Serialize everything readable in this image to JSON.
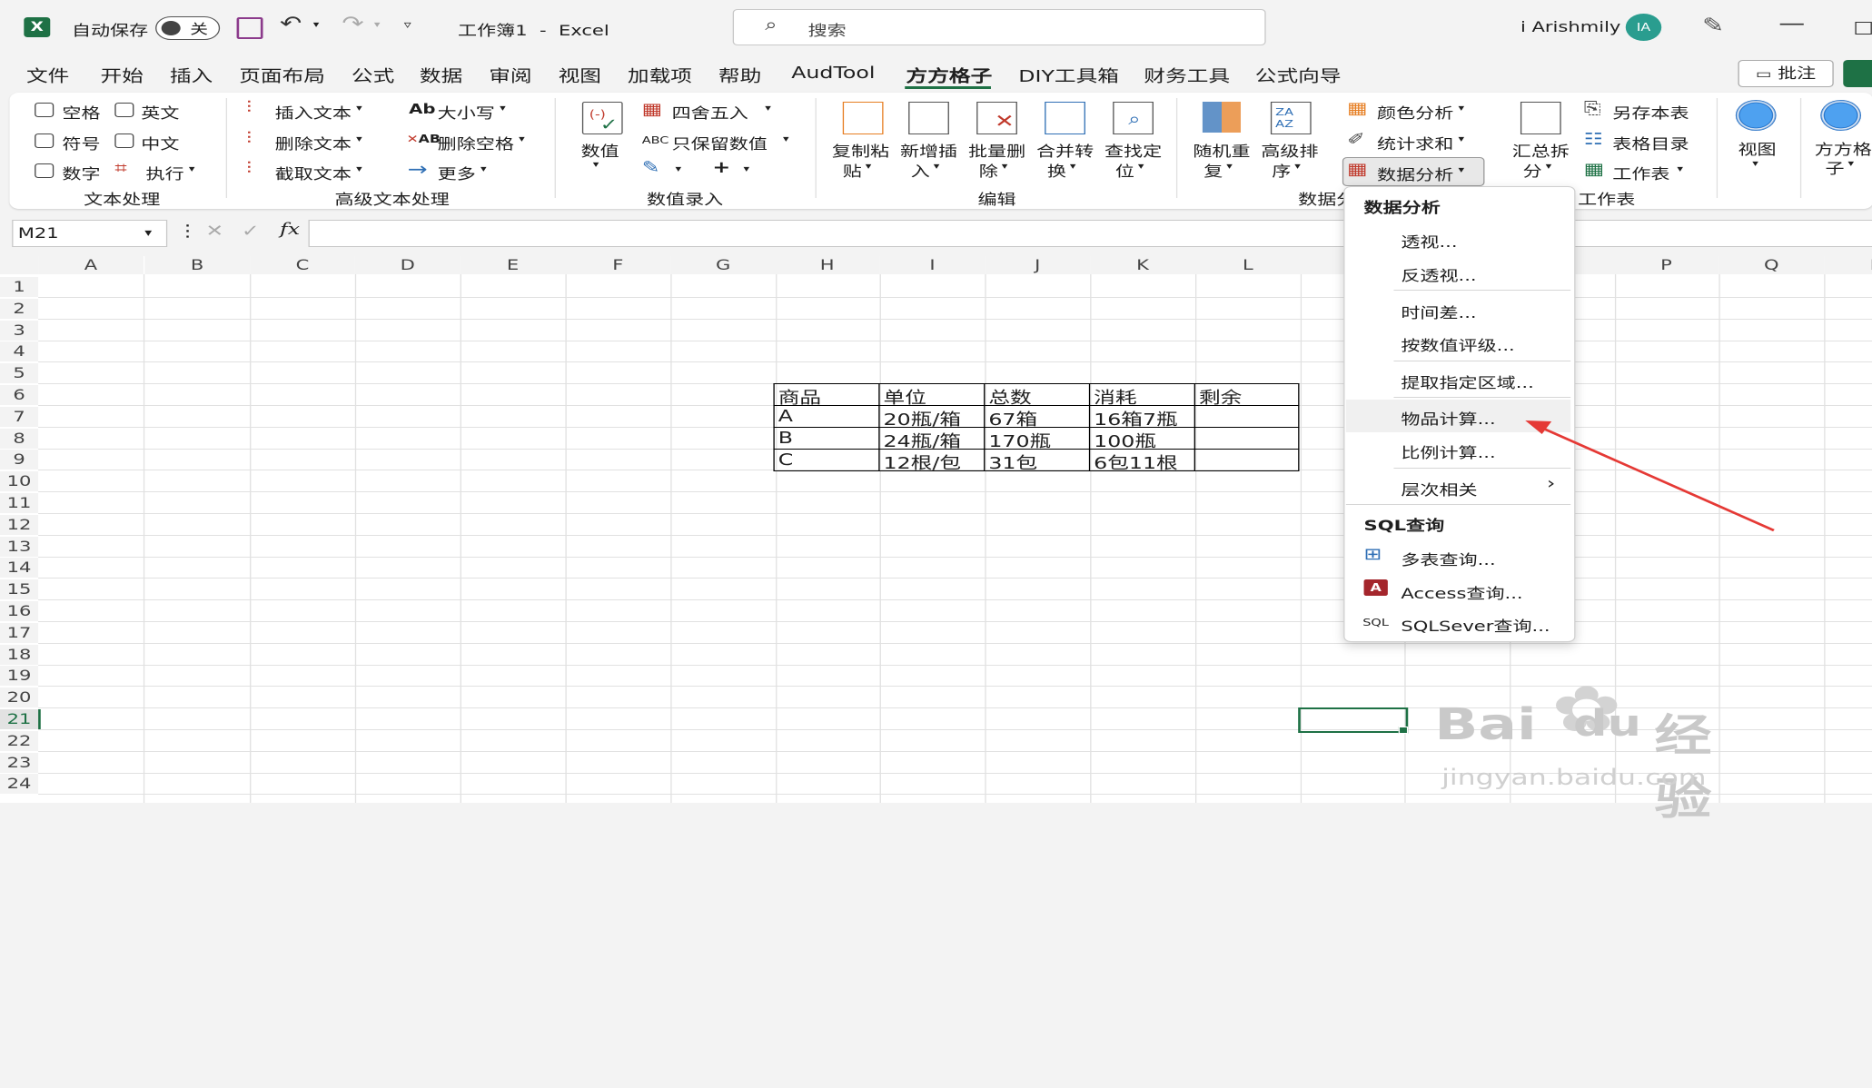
{
  "titlebar": {
    "autosave_label": "自动保存",
    "autosave_state": "关",
    "doc_title": "工作簿1  -  Excel",
    "search_placeholder": "搜索",
    "user_name": "i Arishmily",
    "user_initials": "IA"
  },
  "menu": {
    "tabs": [
      "文件",
      "开始",
      "插入",
      "页面布局",
      "公式",
      "数据",
      "审阅",
      "视图",
      "加载项",
      "帮助",
      "AudTool",
      "方方格子",
      "DIY工具箱",
      "财务工具",
      "公式向导"
    ],
    "active": "方方格子",
    "comment_label": "批注"
  },
  "ribbon": {
    "text": {
      "space": "空格",
      "english": "英文",
      "symbol": "符号",
      "chinese": "中文",
      "number": "数字",
      "execute": "执行",
      "group": "文本处理"
    },
    "advtext": {
      "insert": "插入文本",
      "delete": "删除文本",
      "cut": "截取文本",
      "case": "大小写",
      "del_space": "删除空格",
      "more": "更多",
      "group": "高级文本处理"
    },
    "numinput": {
      "value": "数值",
      "round": "四舍五入",
      "keep_num": "只保留数值",
      "group": "数值录入"
    },
    "edit": {
      "copy": [
        "复制粘",
        "贴"
      ],
      "newins": [
        "新增插",
        "入"
      ],
      "batchdel": [
        "批量删",
        "除"
      ],
      "merge": [
        "合并转",
        "换"
      ],
      "find": [
        "查找定",
        "位"
      ],
      "group": "编辑"
    },
    "data": {
      "random": [
        "随机重",
        "复"
      ],
      "sort": [
        "高级排",
        "序"
      ],
      "color": "颜色分析",
      "stat": "统计求和",
      "analysis": "数据分析",
      "group": "数据分"
    },
    "sheet": {
      "summary": [
        "汇总拆",
        "分"
      ],
      "saveas": "另存本表",
      "toc": "表格目录",
      "worksheet": "工作表",
      "group": "工作表"
    },
    "view": {
      "view": "视图",
      "ffgz": [
        "方方格",
        "子"
      ]
    }
  },
  "formula_bar": {
    "name_box": "M21",
    "fx": "fx"
  },
  "grid": {
    "columns": [
      "A",
      "B",
      "C",
      "D",
      "E",
      "F",
      "G",
      "H",
      "I",
      "J",
      "K",
      "L",
      "",
      "",
      "",
      "P",
      "Q",
      "R"
    ],
    "rows": [
      "1",
      "2",
      "3",
      "4",
      "5",
      "6",
      "7",
      "8",
      "9",
      "10",
      "11",
      "12",
      "13",
      "14",
      "15",
      "16",
      "17",
      "18",
      "19",
      "20",
      "21",
      "22",
      "23",
      "24"
    ],
    "selected_row": "21",
    "table": {
      "header": [
        "商品",
        "单位",
        "总数",
        "消耗",
        "剩余"
      ],
      "rows": [
        [
          "A",
          "20瓶/箱",
          "67箱",
          "16箱7瓶",
          ""
        ],
        [
          "B",
          "24瓶/箱",
          "170瓶",
          "100瓶",
          ""
        ],
        [
          "C",
          "12根/包",
          "31包",
          "6包11根",
          ""
        ]
      ]
    }
  },
  "dropdown": {
    "section1": "数据分析",
    "items1": [
      "透视...",
      "反透视...",
      "时间差...",
      "按数值评级...",
      "提取指定区域...",
      "物品计算...",
      "比例计算...",
      "层次相关"
    ],
    "section2": "SQL查询",
    "items2": [
      "多表查询...",
      "Access查询...",
      "SQLSever查询..."
    ],
    "sql_tag": "SQL"
  },
  "watermark": {
    "brand": "Bai",
    "brand2": "du",
    "cn": "经验",
    "url": "jingyan.baidu.com"
  },
  "colors": {
    "excel_green": "#1e7145",
    "arrow_red": "#e53935"
  }
}
